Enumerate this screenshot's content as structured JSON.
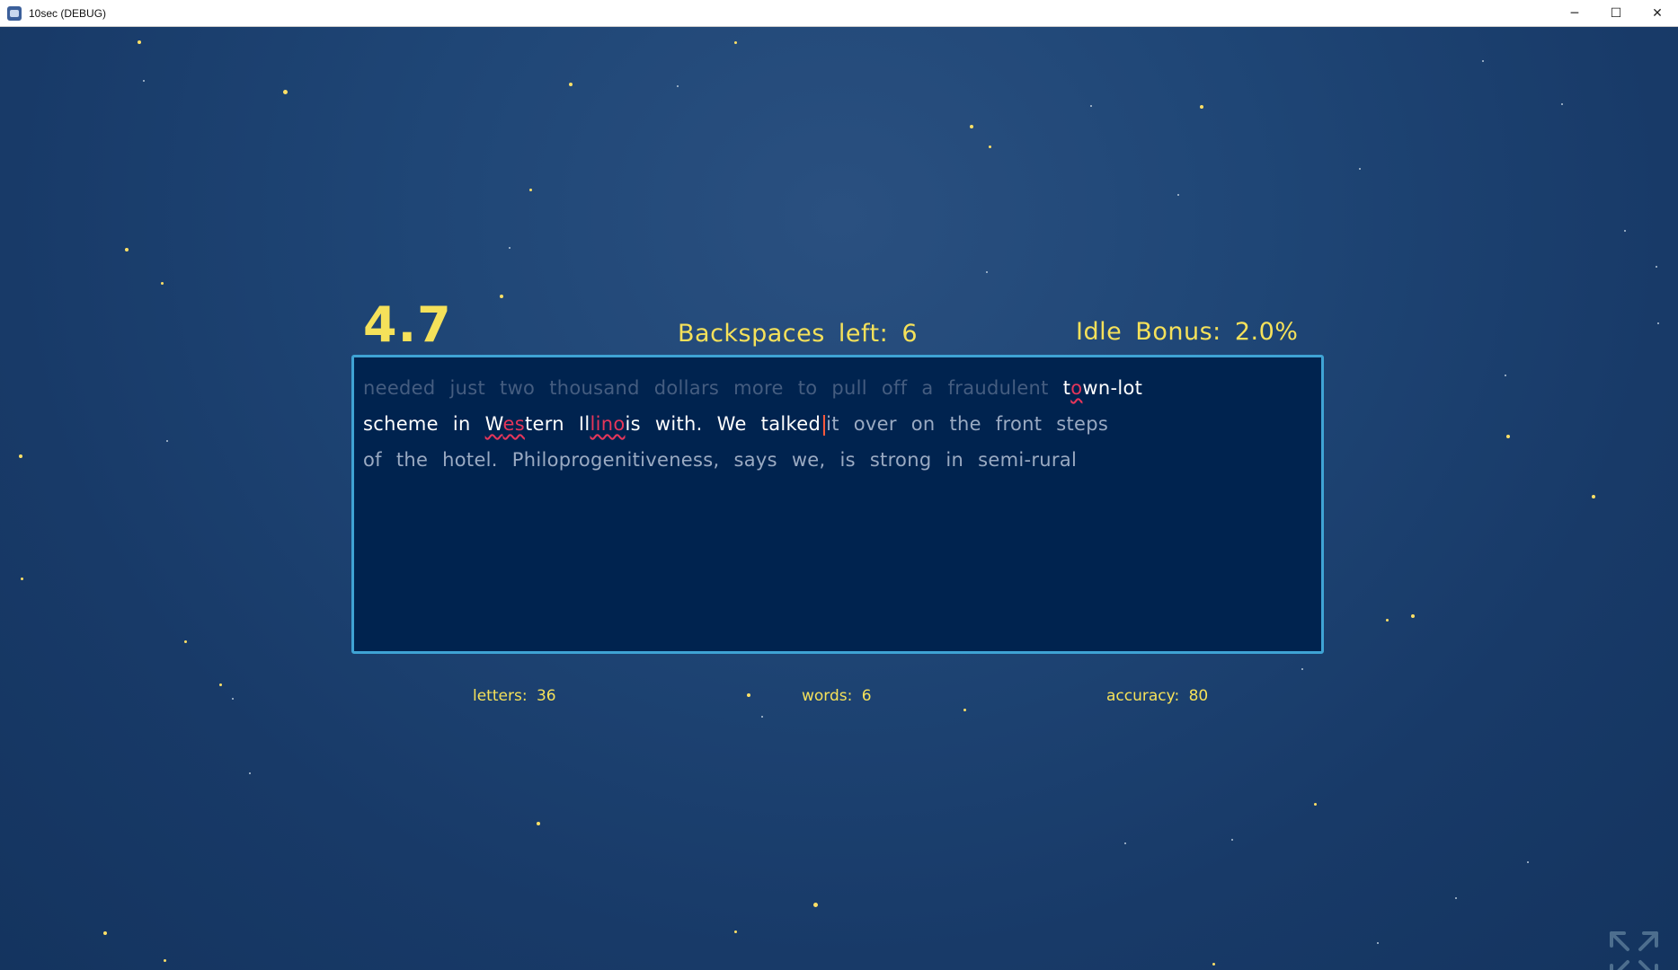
{
  "window": {
    "title": "10sec (DEBUG)",
    "controls": {
      "minimize": "─",
      "maximize": "☐",
      "close": "✕"
    }
  },
  "hud": {
    "timer": "4.7",
    "backspaces_label": "Backspaces left:",
    "backspaces_value": "6",
    "idle_label": "Idle Bonus:",
    "idle_value": "2.0%"
  },
  "text": {
    "line1": {
      "done_words": [
        "needed",
        "just",
        "two",
        "thousand",
        "dollars",
        "more",
        "to",
        "pull",
        "off",
        "a",
        "fraudulent"
      ],
      "w_t": "t",
      "w_o": "o",
      "w_rest": "wn-lot"
    },
    "line2": {
      "scheme": "scheme",
      "in": "in",
      "western_w": "W",
      "western_es": "es",
      "western_tern": "tern",
      "illinois_il": "Il",
      "illinois_lino": "lino",
      "illinois_is": "is",
      "with": "with.",
      "we": "We",
      "talked": "talked",
      "future": "it over on the front steps"
    },
    "line3": "of the hotel. Philoprogenitiveness, says we, is strong in semi-rural"
  },
  "stats": {
    "letters_label": "letters:",
    "letters_value": "36",
    "words_label": "words:",
    "words_value": "6",
    "accuracy_label": "accuracy:",
    "accuracy_value": "80"
  },
  "icons": {
    "app": "app-icon",
    "fullscreen": "fullscreen-icon"
  },
  "colors": {
    "hud_yellow": "#f5e15a",
    "box_border": "#3fa3d4",
    "box_bg": "#00234f",
    "error": "#e6365a",
    "caret": "#ff5a3c"
  }
}
